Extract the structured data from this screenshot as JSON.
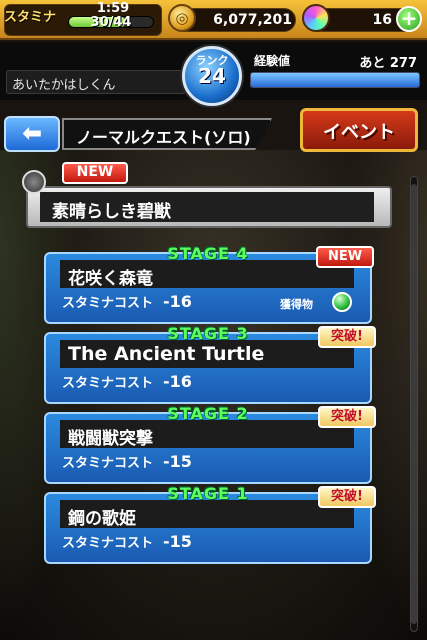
{
  "topbar": {
    "stamina_label": "スタミナ",
    "stamina_timer": "1:59",
    "stamina_value": "30/44",
    "gold": "6,077,201",
    "orbs": "16",
    "plus_icon": "+"
  },
  "player": {
    "name": "あいたかはしくん",
    "rank_label": "ランク",
    "rank": "24",
    "exp_label": "経験値",
    "exp_remaining": "あと 277"
  },
  "nav": {
    "back_arrow": "⬅",
    "title": "ノーマルクエスト(ソロ)",
    "event_label": "イベント"
  },
  "quest": {
    "new_badge": "NEW",
    "name": "素晴らしき碧獣"
  },
  "stages": [
    {
      "label": "STAGE 4",
      "title": "花咲く森竜",
      "cost_label": "スタミナコスト",
      "cost": "-16",
      "badge": "NEW",
      "drop_label": "獲得物"
    },
    {
      "label": "STAGE 3",
      "title": "The Ancient Turtle",
      "cost_label": "スタミナコスト",
      "cost": "-16",
      "badge": "突破!"
    },
    {
      "label": "STAGE 2",
      "title": "戦闘獣突撃",
      "cost_label": "スタミナコスト",
      "cost": "-15",
      "badge": "突破!"
    },
    {
      "label": "STAGE 1",
      "title": "鋼の歌姫",
      "cost_label": "スタミナコスト",
      "cost": "-15",
      "badge": "突破!"
    }
  ],
  "colors": {
    "stage_label": "#5cff5c",
    "card_blue": "#1a5ab0",
    "topbar_gold": "#f6c23a"
  }
}
